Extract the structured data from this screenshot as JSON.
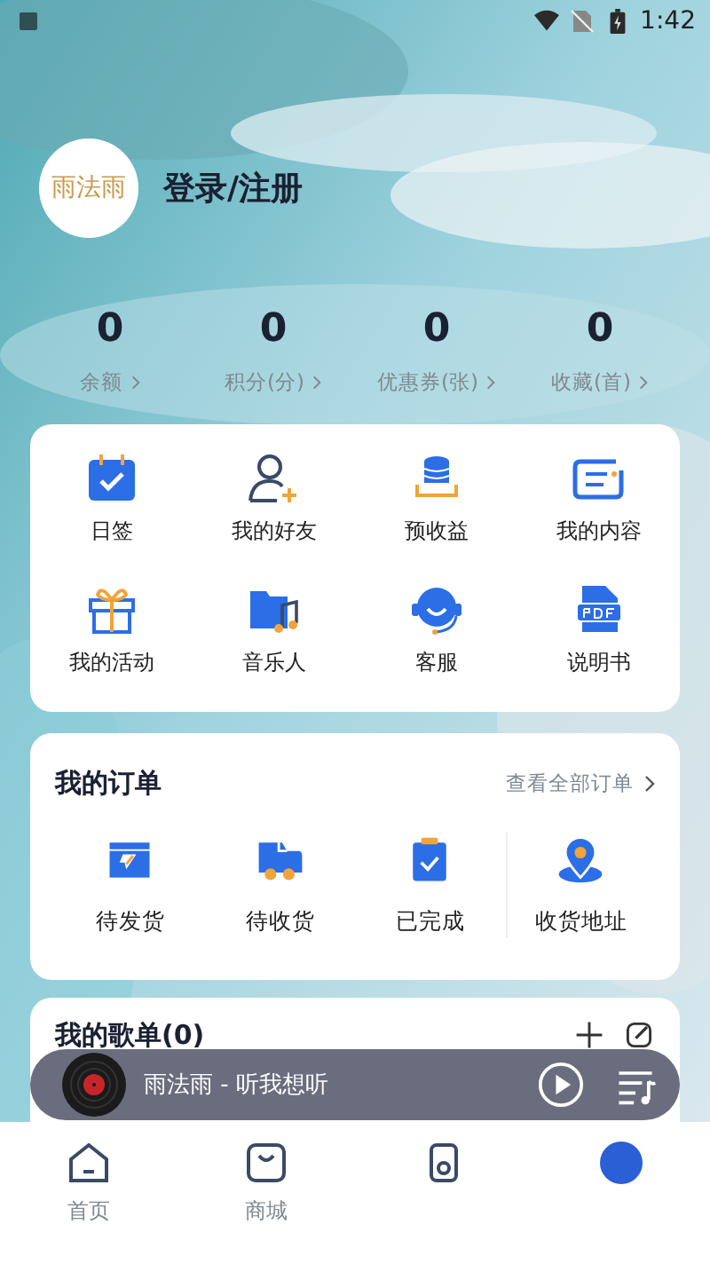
{
  "status_bar": {
    "time": "1:42"
  },
  "profile": {
    "avatar_text": "雨法雨",
    "login_label": "登录/注册"
  },
  "stats": [
    {
      "value": "0",
      "label": "余额"
    },
    {
      "value": "0",
      "label": "积分(分)"
    },
    {
      "value": "0",
      "label": "优惠券(张)"
    },
    {
      "value": "0",
      "label": "收藏(首)"
    }
  ],
  "shortcuts": [
    {
      "kind": "calendar",
      "label": "日签"
    },
    {
      "kind": "friend",
      "label": "我的好友"
    },
    {
      "kind": "coins",
      "label": "预收益"
    },
    {
      "kind": "content",
      "label": "我的内容"
    },
    {
      "kind": "gift",
      "label": "我的活动"
    },
    {
      "kind": "music",
      "label": "音乐人"
    },
    {
      "kind": "service",
      "label": "客服"
    },
    {
      "kind": "pdf",
      "label": "说明书"
    }
  ],
  "orders": {
    "title": "我的订单",
    "view_all": "查看全部订单",
    "items": [
      {
        "kind": "box",
        "label": "待发货"
      },
      {
        "kind": "truck",
        "label": "待收货"
      },
      {
        "kind": "clipboard",
        "label": "已完成"
      },
      {
        "kind": "pin",
        "label": "收货地址"
      }
    ]
  },
  "playlist": {
    "title": "我的歌单(0)"
  },
  "player": {
    "track": "雨法雨 - 听我想听"
  },
  "tabs": [
    {
      "kind": "home",
      "label": "首页",
      "selected": false
    },
    {
      "kind": "shop",
      "label": "商城",
      "selected": false
    },
    {
      "kind": "speaker",
      "selected": false
    },
    {
      "kind": "me",
      "selected": true
    }
  ]
}
